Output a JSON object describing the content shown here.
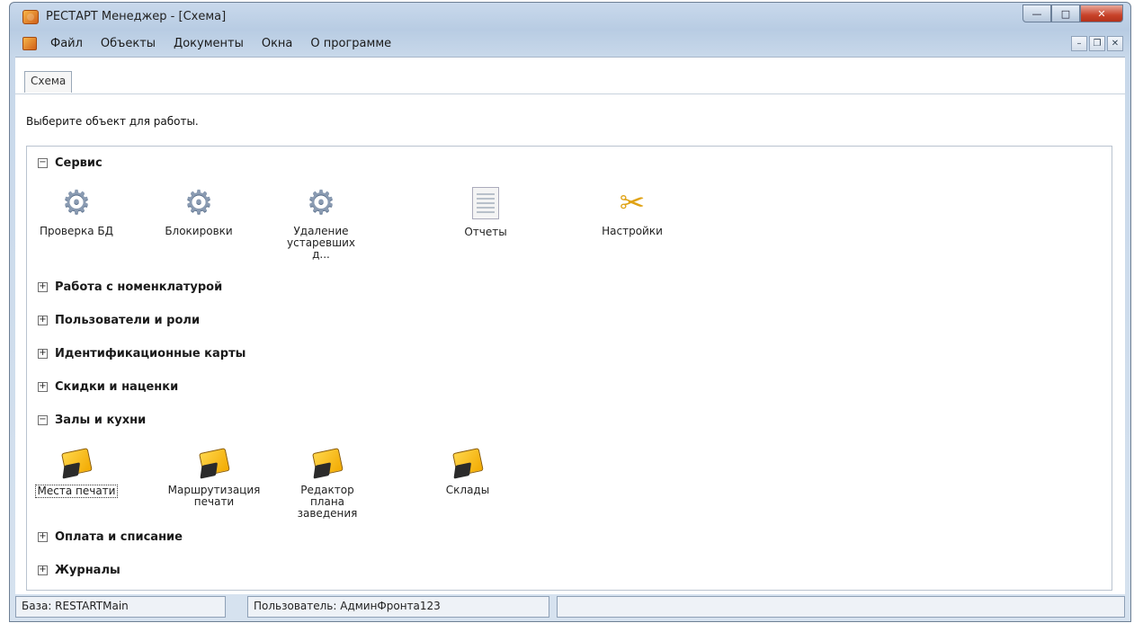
{
  "window": {
    "title": "РЕСТАРТ Менеджер - [Схема]",
    "buttons": {
      "minimize": "—",
      "maximize": "□",
      "close": "✕"
    }
  },
  "menu": {
    "items": [
      "Файл",
      "Объекты",
      "Документы",
      "Окна",
      "О программе"
    ],
    "mdi": {
      "minimize": "–",
      "restore": "❐",
      "close": "✕"
    }
  },
  "tabs": [
    {
      "label": "Схема"
    }
  ],
  "prompt": "Выберите объект для работы.",
  "groups": [
    {
      "title": "Сервис",
      "expanded": true,
      "toggle": "−",
      "items": [
        {
          "label": "Проверка БД",
          "icon": "gear-icon"
        },
        {
          "label": "Блокировки",
          "icon": "gear-icon"
        },
        {
          "label": "Удаление устаревших д...",
          "icon": "gear-icon"
        },
        {
          "label": "Отчеты",
          "icon": "report-icon"
        },
        {
          "label": "Настройки",
          "icon": "tools-icon"
        }
      ]
    },
    {
      "title": "Работа с номенклатурой",
      "expanded": false,
      "toggle": "+"
    },
    {
      "title": "Пользователи и роли",
      "expanded": false,
      "toggle": "+"
    },
    {
      "title": "Идентификационные карты",
      "expanded": false,
      "toggle": "+"
    },
    {
      "title": "Скидки и наценки",
      "expanded": false,
      "toggle": "+"
    },
    {
      "title": "Залы и кухни",
      "expanded": true,
      "toggle": "−",
      "items": [
        {
          "label": "Места печати",
          "icon": "book-icon",
          "selected": true
        },
        {
          "label": "Маршрутизация печати",
          "icon": "book-icon"
        },
        {
          "label": "Редактор плана заведения",
          "icon": "book-icon"
        },
        {
          "label": "Склады",
          "icon": "book-icon"
        }
      ]
    },
    {
      "title": "Оплата и списание",
      "expanded": false,
      "toggle": "+"
    },
    {
      "title": "Журналы",
      "expanded": false,
      "toggle": "+"
    }
  ],
  "status": {
    "base": "База: RESTARTMain",
    "user": "Пользователь: АдминФронта123"
  },
  "colors": {
    "titlebar": "#c9d9ec",
    "close_button": "#c8432a",
    "book": "#f2a900"
  }
}
